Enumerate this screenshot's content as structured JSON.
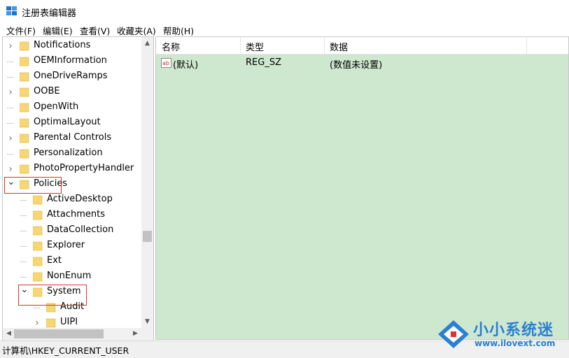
{
  "window": {
    "title": "注册表编辑器"
  },
  "menu": [
    "文件(F)",
    "编辑(E)",
    "查看(V)",
    "收藏夹(A)",
    "帮助(H)"
  ],
  "tree": {
    "nodes": [
      {
        "label": "Notifications",
        "depth": 1,
        "expander": ">"
      },
      {
        "label": "OEMInformation",
        "depth": 1,
        "expander": ""
      },
      {
        "label": "OneDriveRamps",
        "depth": 1,
        "expander": ""
      },
      {
        "label": "OOBE",
        "depth": 1,
        "expander": ">"
      },
      {
        "label": "OpenWith",
        "depth": 1,
        "expander": ""
      },
      {
        "label": "OptimalLayout",
        "depth": 1,
        "expander": ""
      },
      {
        "label": "Parental Controls",
        "depth": 1,
        "expander": ">"
      },
      {
        "label": "Personalization",
        "depth": 1,
        "expander": ""
      },
      {
        "label": "PhotoPropertyHandler",
        "depth": 1,
        "expander": ">"
      },
      {
        "label": "Policies",
        "depth": 1,
        "expander": "v"
      },
      {
        "label": "ActiveDesktop",
        "depth": 2,
        "expander": ""
      },
      {
        "label": "Attachments",
        "depth": 2,
        "expander": ""
      },
      {
        "label": "DataCollection",
        "depth": 2,
        "expander": ""
      },
      {
        "label": "Explorer",
        "depth": 2,
        "expander": ""
      },
      {
        "label": "Ext",
        "depth": 2,
        "expander": ""
      },
      {
        "label": "NonEnum",
        "depth": 2,
        "expander": ""
      },
      {
        "label": "System",
        "depth": 2,
        "expander": "v"
      },
      {
        "label": "Audit",
        "depth": 3,
        "expander": ""
      },
      {
        "label": "UIPI",
        "depth": 3,
        "expander": ">"
      }
    ]
  },
  "list": {
    "columns": [
      "名称",
      "类型",
      "数据"
    ],
    "rows": [
      {
        "name": "(默认)",
        "type": "REG_SZ",
        "data": "(数值未设置)"
      }
    ]
  },
  "status": {
    "path": "计算机\\HKEY_CURRENT_USER"
  },
  "watermark": {
    "text": "小小系统迷",
    "url": "www.ilovext.com"
  },
  "colors": {
    "list_bg": "#cde8cf",
    "folder": "#f7d674",
    "highlight_box": "#e03030",
    "watermark": "#2a7fd4"
  }
}
